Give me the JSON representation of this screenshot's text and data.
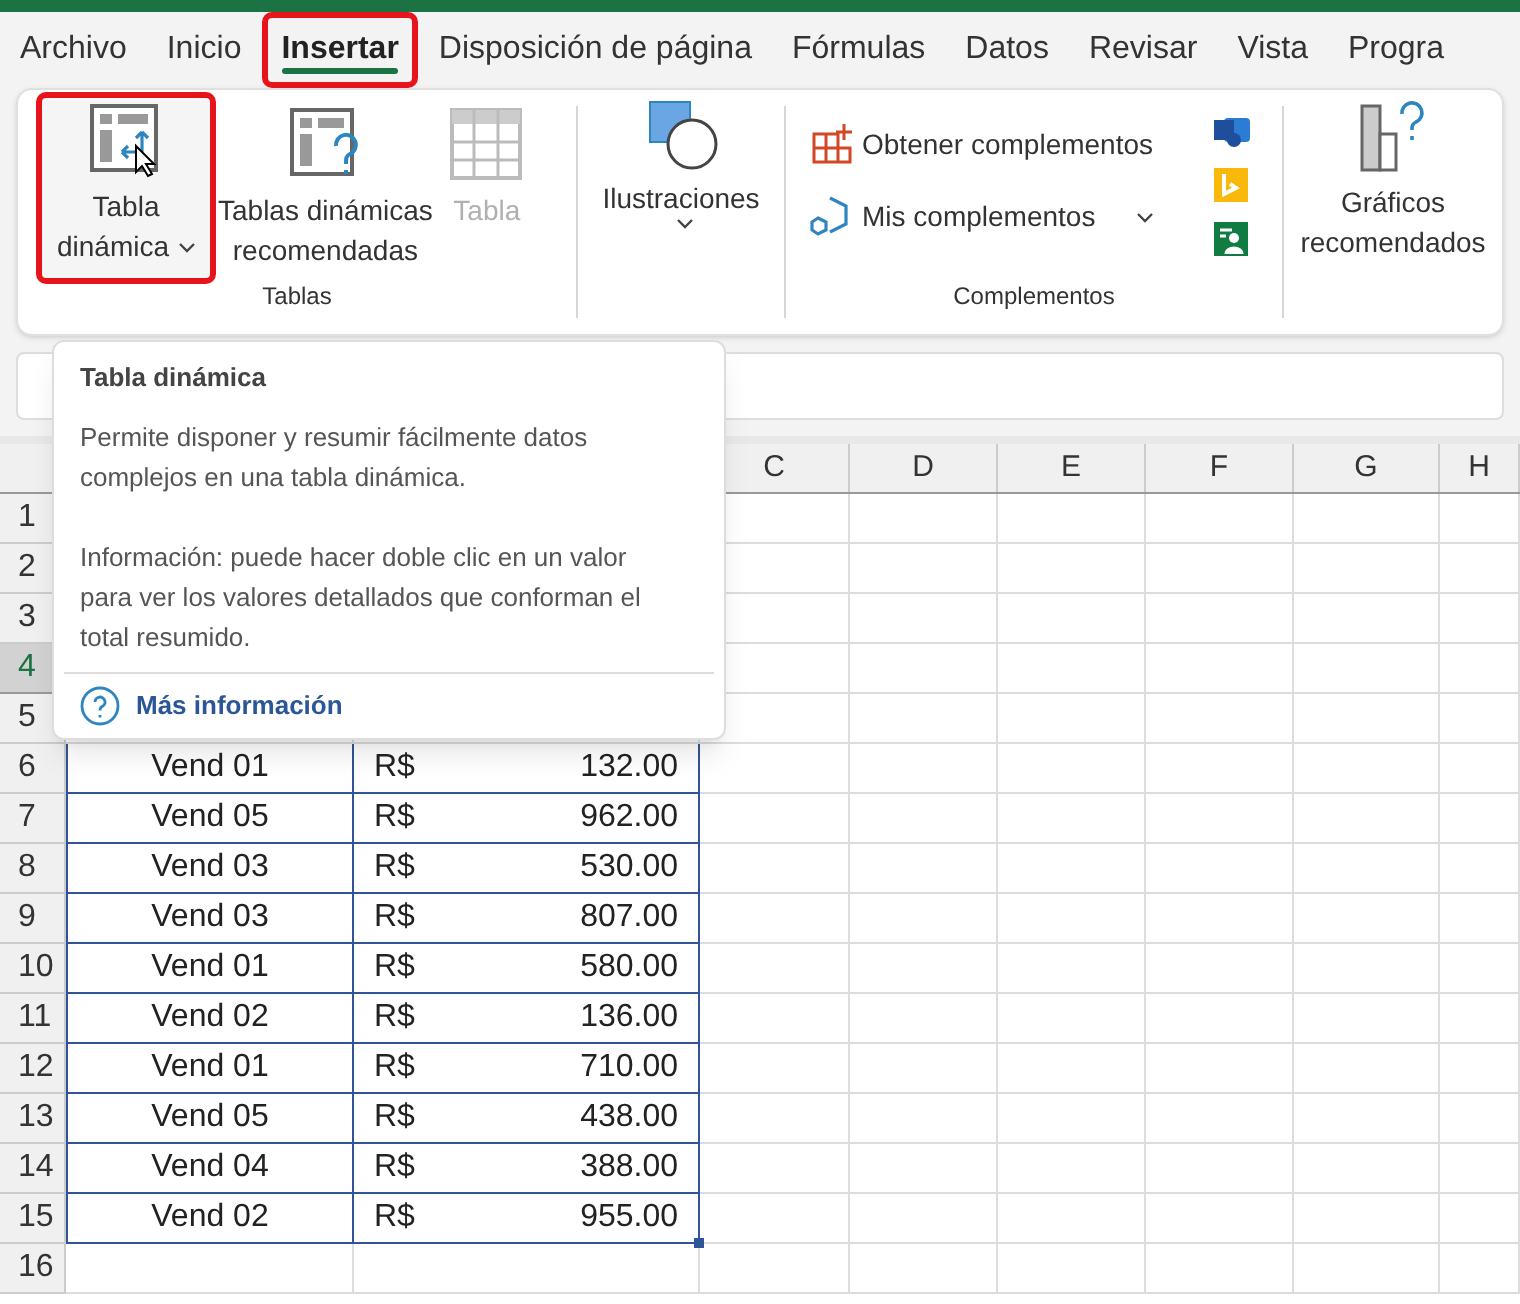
{
  "tabs": [
    {
      "label": "Archivo",
      "selected": false,
      "highlighted": false
    },
    {
      "label": "Inicio",
      "selected": false,
      "highlighted": false
    },
    {
      "label": "Insertar",
      "selected": true,
      "highlighted": true
    },
    {
      "label": "Disposición de página",
      "selected": false,
      "highlighted": false
    },
    {
      "label": "Fórmulas",
      "selected": false,
      "highlighted": false
    },
    {
      "label": "Datos",
      "selected": false,
      "highlighted": false
    },
    {
      "label": "Revisar",
      "selected": false,
      "highlighted": false
    },
    {
      "label": "Vista",
      "selected": false,
      "highlighted": false
    },
    {
      "label": "Progra",
      "selected": false,
      "highlighted": false
    }
  ],
  "ribbon": {
    "tablas": {
      "label": "Tablas",
      "buttons": [
        {
          "kind": "pivot",
          "lines": [
            "Tabla",
            "dinámica"
          ],
          "dropdown": true,
          "disabled": false,
          "highlighted": true
        },
        {
          "kind": "recommended",
          "lines": [
            "Tablas dinámicas",
            "recomendadas"
          ],
          "dropdown": false,
          "disabled": false,
          "highlighted": false
        },
        {
          "kind": "table",
          "lines": [
            "Tabla"
          ],
          "dropdown": false,
          "disabled": true,
          "highlighted": false
        }
      ]
    },
    "ilustraciones": {
      "label": "Ilustraciones"
    },
    "complementos": {
      "label": "Complementos",
      "items": [
        {
          "kind": "get",
          "label": "Obtener complementos",
          "dropdown": false
        },
        {
          "kind": "mine",
          "label": "Mis complementos",
          "dropdown": true
        }
      ]
    },
    "graficos": {
      "lines": [
        "Gráficos",
        "recomendados"
      ]
    }
  },
  "tooltip": {
    "title": "Tabla dinámica",
    "paragraphs": [
      "Permite disponer y resumir fácilmente datos complejos en una tabla dinámica.",
      "Información: puede hacer doble clic en un valor para ver los valores detallados que conforman el total resumido."
    ],
    "link": "Más información"
  },
  "sheet": {
    "columns": [
      "C",
      "D",
      "E",
      "F",
      "G",
      "H"
    ],
    "rows": [
      {
        "number": "1",
        "selected": false,
        "cells": []
      },
      {
        "number": "2",
        "selected": false,
        "cells": []
      },
      {
        "number": "3",
        "selected": false,
        "cells": []
      },
      {
        "number": "4",
        "selected": true,
        "cells": []
      },
      {
        "number": "5",
        "selected": false,
        "cells": []
      },
      {
        "number": "6",
        "selected": false,
        "cells": [
          "Vend 01",
          "R$",
          "132.00"
        ]
      },
      {
        "number": "7",
        "selected": false,
        "cells": [
          "Vend 05",
          "R$",
          "962.00"
        ]
      },
      {
        "number": "8",
        "selected": false,
        "cells": [
          "Vend 03",
          "R$",
          "530.00"
        ]
      },
      {
        "number": "9",
        "selected": false,
        "cells": [
          "Vend 03",
          "R$",
          "807.00"
        ]
      },
      {
        "number": "10",
        "selected": false,
        "cells": [
          "Vend 01",
          "R$",
          "580.00"
        ]
      },
      {
        "number": "11",
        "selected": false,
        "cells": [
          "Vend 02",
          "R$",
          "136.00"
        ]
      },
      {
        "number": "12",
        "selected": false,
        "cells": [
          "Vend 01",
          "R$",
          "710.00"
        ]
      },
      {
        "number": "13",
        "selected": false,
        "cells": [
          "Vend 05",
          "R$",
          "438.00"
        ]
      },
      {
        "number": "14",
        "selected": false,
        "cells": [
          "Vend 04",
          "R$",
          "388.00"
        ]
      },
      {
        "number": "15",
        "selected": false,
        "cells": [
          "Vend 02",
          "R$",
          "955.00"
        ]
      },
      {
        "number": "16",
        "selected": false,
        "cells": []
      }
    ]
  }
}
